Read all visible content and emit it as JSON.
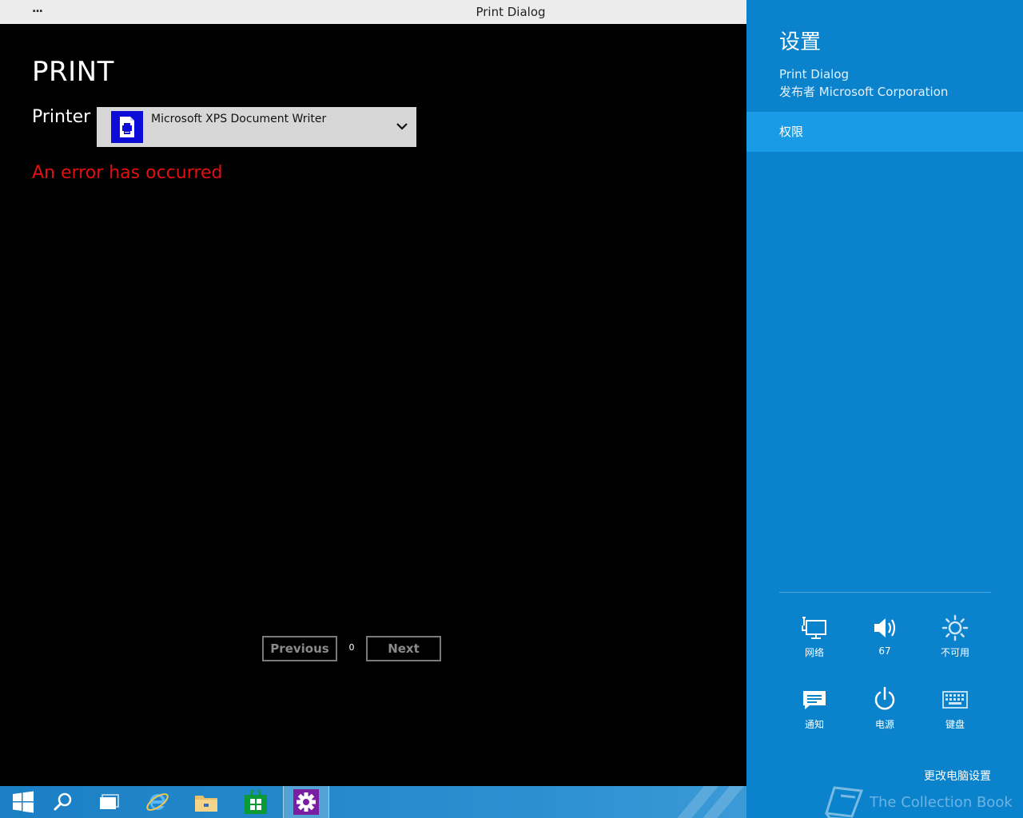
{
  "window": {
    "menu_glyph": "...",
    "title": "Print Dialog"
  },
  "main": {
    "heading": "PRINT",
    "printer_label": "Printer",
    "printer_selected": "Microsoft XPS Document Writer",
    "error_message": "An error has occurred",
    "pager": {
      "previous_label": "Previous",
      "page_number": "0",
      "next_label": "Next"
    }
  },
  "taskbar": {
    "items": [
      "start-icon",
      "search-icon",
      "task-view-icon",
      "internet-explorer-icon",
      "file-explorer-icon",
      "store-icon",
      "settings-app-icon"
    ]
  },
  "charm": {
    "title": "设置",
    "app_name": "Print Dialog",
    "publisher": "发布者 Microsoft Corporation",
    "permissions_label": "权限",
    "quick_settings": [
      {
        "icon": "network-icon",
        "label": "网络"
      },
      {
        "icon": "volume-icon",
        "label": "67"
      },
      {
        "icon": "brightness-icon",
        "label": "不可用"
      },
      {
        "icon": "notifications-icon",
        "label": "通知"
      },
      {
        "icon": "power-icon",
        "label": "电源"
      },
      {
        "icon": "keyboard-icon",
        "label": "键盘"
      }
    ],
    "change_pc_settings": "更改电脑设置",
    "watermark": "The Collection Book"
  },
  "colors": {
    "charm_bg": "#0b82cc",
    "charm_highlight": "#1a9be6",
    "error_red": "#e01010",
    "printer_icon_bg": "#0c0cd6",
    "store_green": "#0a9a3a",
    "settings_purple": "#7a1fa2"
  }
}
